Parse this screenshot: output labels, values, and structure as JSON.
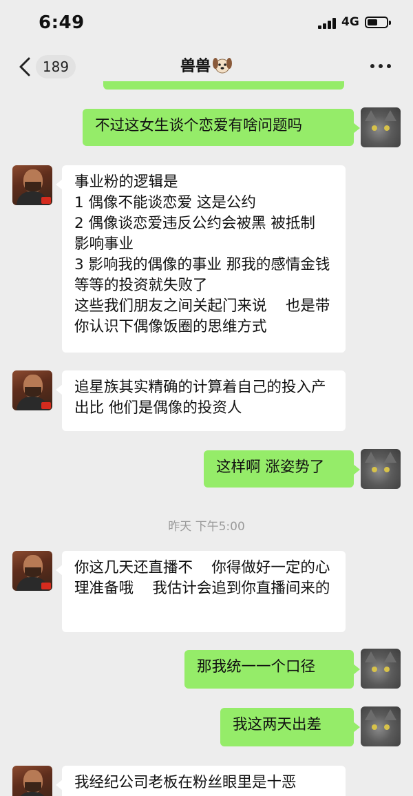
{
  "status_bar": {
    "time": "6:49",
    "network": "4G"
  },
  "nav": {
    "back_count": "189",
    "title": "兽兽",
    "title_icon": "dog-face-icon"
  },
  "messages": [
    {
      "from": "me",
      "text": "不过这女生谈个恋爱有啥问题吗"
    },
    {
      "from": "other",
      "text": "事业粉的逻辑是\n1 偶像不能谈恋爱 这是公约\n2 偶像谈恋爱违反公约会被黑 被抵制  影响事业\n3 影响我的偶像的事业 那我的感情金钱等等的投资就失败了\n这些我们朋友之间关起门来说    也是带你认识下偶像饭圈的思维方式"
    },
    {
      "from": "other",
      "text": "追星族其实精确的计算着自己的投入产出比 他们是偶像的投资人"
    },
    {
      "from": "me",
      "text": "这样啊 涨姿势了"
    },
    {
      "from": "time",
      "text": "昨天 下午5:00"
    },
    {
      "from": "other",
      "text": "你这几天还直播不    你得做好一定的心理准备哦    我估计会追到你直播间来的"
    },
    {
      "from": "me",
      "text": "那我统一一个口径"
    },
    {
      "from": "me",
      "text": "我这两天出差"
    },
    {
      "from": "other",
      "text": "我经纪公司老板在粉丝眼里是十恶"
    }
  ],
  "colors": {
    "background": "#ededed",
    "my_bubble": "#95ec69",
    "other_bubble": "#ffffff"
  }
}
